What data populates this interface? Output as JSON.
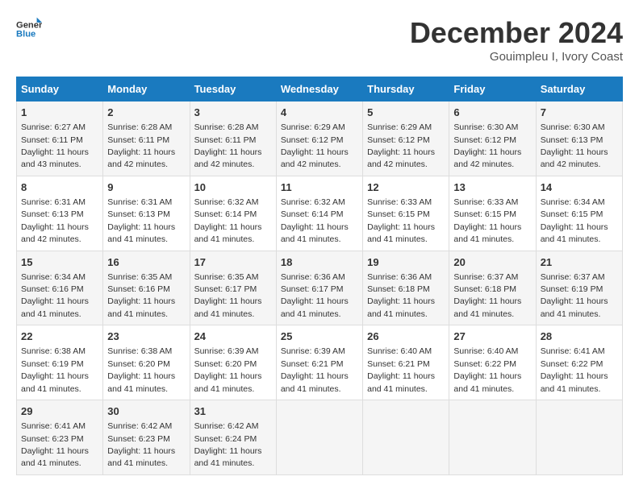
{
  "logo": {
    "line1": "General",
    "line2": "Blue"
  },
  "title": "December 2024",
  "location": "Gouimpleu I, Ivory Coast",
  "days_of_week": [
    "Sunday",
    "Monday",
    "Tuesday",
    "Wednesday",
    "Thursday",
    "Friday",
    "Saturday"
  ],
  "weeks": [
    [
      {
        "day": "1",
        "sunrise": "6:27 AM",
        "sunset": "6:11 PM",
        "daylight": "11 hours and 43 minutes."
      },
      {
        "day": "2",
        "sunrise": "6:28 AM",
        "sunset": "6:11 PM",
        "daylight": "11 hours and 42 minutes."
      },
      {
        "day": "3",
        "sunrise": "6:28 AM",
        "sunset": "6:11 PM",
        "daylight": "11 hours and 42 minutes."
      },
      {
        "day": "4",
        "sunrise": "6:29 AM",
        "sunset": "6:12 PM",
        "daylight": "11 hours and 42 minutes."
      },
      {
        "day": "5",
        "sunrise": "6:29 AM",
        "sunset": "6:12 PM",
        "daylight": "11 hours and 42 minutes."
      },
      {
        "day": "6",
        "sunrise": "6:30 AM",
        "sunset": "6:12 PM",
        "daylight": "11 hours and 42 minutes."
      },
      {
        "day": "7",
        "sunrise": "6:30 AM",
        "sunset": "6:13 PM",
        "daylight": "11 hours and 42 minutes."
      }
    ],
    [
      {
        "day": "8",
        "sunrise": "6:31 AM",
        "sunset": "6:13 PM",
        "daylight": "11 hours and 42 minutes."
      },
      {
        "day": "9",
        "sunrise": "6:31 AM",
        "sunset": "6:13 PM",
        "daylight": "11 hours and 41 minutes."
      },
      {
        "day": "10",
        "sunrise": "6:32 AM",
        "sunset": "6:14 PM",
        "daylight": "11 hours and 41 minutes."
      },
      {
        "day": "11",
        "sunrise": "6:32 AM",
        "sunset": "6:14 PM",
        "daylight": "11 hours and 41 minutes."
      },
      {
        "day": "12",
        "sunrise": "6:33 AM",
        "sunset": "6:15 PM",
        "daylight": "11 hours and 41 minutes."
      },
      {
        "day": "13",
        "sunrise": "6:33 AM",
        "sunset": "6:15 PM",
        "daylight": "11 hours and 41 minutes."
      },
      {
        "day": "14",
        "sunrise": "6:34 AM",
        "sunset": "6:15 PM",
        "daylight": "11 hours and 41 minutes."
      }
    ],
    [
      {
        "day": "15",
        "sunrise": "6:34 AM",
        "sunset": "6:16 PM",
        "daylight": "11 hours and 41 minutes."
      },
      {
        "day": "16",
        "sunrise": "6:35 AM",
        "sunset": "6:16 PM",
        "daylight": "11 hours and 41 minutes."
      },
      {
        "day": "17",
        "sunrise": "6:35 AM",
        "sunset": "6:17 PM",
        "daylight": "11 hours and 41 minutes."
      },
      {
        "day": "18",
        "sunrise": "6:36 AM",
        "sunset": "6:17 PM",
        "daylight": "11 hours and 41 minutes."
      },
      {
        "day": "19",
        "sunrise": "6:36 AM",
        "sunset": "6:18 PM",
        "daylight": "11 hours and 41 minutes."
      },
      {
        "day": "20",
        "sunrise": "6:37 AM",
        "sunset": "6:18 PM",
        "daylight": "11 hours and 41 minutes."
      },
      {
        "day": "21",
        "sunrise": "6:37 AM",
        "sunset": "6:19 PM",
        "daylight": "11 hours and 41 minutes."
      }
    ],
    [
      {
        "day": "22",
        "sunrise": "6:38 AM",
        "sunset": "6:19 PM",
        "daylight": "11 hours and 41 minutes."
      },
      {
        "day": "23",
        "sunrise": "6:38 AM",
        "sunset": "6:20 PM",
        "daylight": "11 hours and 41 minutes."
      },
      {
        "day": "24",
        "sunrise": "6:39 AM",
        "sunset": "6:20 PM",
        "daylight": "11 hours and 41 minutes."
      },
      {
        "day": "25",
        "sunrise": "6:39 AM",
        "sunset": "6:21 PM",
        "daylight": "11 hours and 41 minutes."
      },
      {
        "day": "26",
        "sunrise": "6:40 AM",
        "sunset": "6:21 PM",
        "daylight": "11 hours and 41 minutes."
      },
      {
        "day": "27",
        "sunrise": "6:40 AM",
        "sunset": "6:22 PM",
        "daylight": "11 hours and 41 minutes."
      },
      {
        "day": "28",
        "sunrise": "6:41 AM",
        "sunset": "6:22 PM",
        "daylight": "11 hours and 41 minutes."
      }
    ],
    [
      {
        "day": "29",
        "sunrise": "6:41 AM",
        "sunset": "6:23 PM",
        "daylight": "11 hours and 41 minutes."
      },
      {
        "day": "30",
        "sunrise": "6:42 AM",
        "sunset": "6:23 PM",
        "daylight": "11 hours and 41 minutes."
      },
      {
        "day": "31",
        "sunrise": "6:42 AM",
        "sunset": "6:24 PM",
        "daylight": "11 hours and 41 minutes."
      },
      null,
      null,
      null,
      null
    ]
  ]
}
